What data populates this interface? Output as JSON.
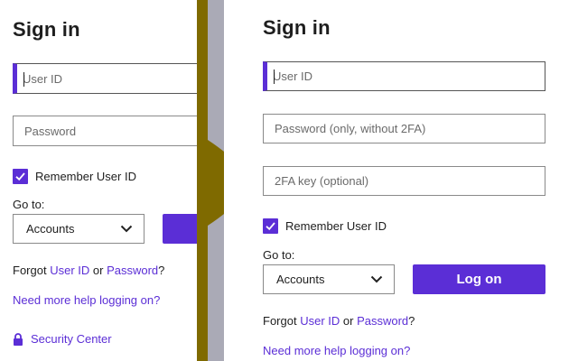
{
  "colors": {
    "accent": "#5b2ed6",
    "divider_gray": "#aaaab6",
    "divider_olive": "#7f6a00"
  },
  "left": {
    "title": "Sign in",
    "user_id_placeholder": "User ID",
    "password_placeholder": "Password",
    "remember_label": "Remember User ID",
    "goto_label": "Go to:",
    "goto_value": "Accounts",
    "forgot_prefix": "Forgot",
    "user_id_link": "User ID",
    "or_text": "or",
    "password_link": "Password",
    "question_mark": "?",
    "help_link": "Need more help logging on?",
    "security_link": "Security Center"
  },
  "right": {
    "title": "Sign in",
    "user_id_placeholder": "User ID",
    "password_placeholder": "Password (only, without 2FA)",
    "twofa_placeholder": "2FA key (optional)",
    "remember_label": "Remember User ID",
    "goto_label": "Go to:",
    "goto_value": "Accounts",
    "logon_label": "Log on",
    "forgot_prefix": "Forgot",
    "user_id_link": "User ID",
    "or_text": "or",
    "password_link": "Password",
    "question_mark": "?",
    "help_link": "Need more help logging on?"
  },
  "icons": {
    "checkbox": "check-icon",
    "select": "chevron-down-icon",
    "security": "lock-icon",
    "transition": "arrow-right-icon"
  }
}
